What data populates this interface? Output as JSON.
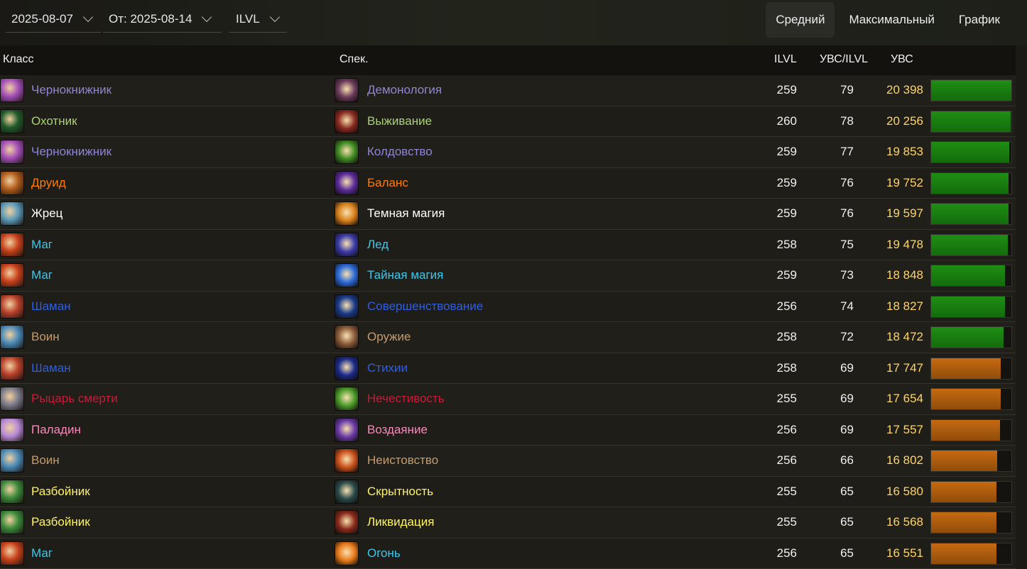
{
  "filters": {
    "date_from": "2025-08-07",
    "date_to": "От: 2025-08-14",
    "ilvl": "ILVL"
  },
  "tabs": [
    {
      "label": "Средний",
      "active": true
    },
    {
      "label": "Максимальный",
      "active": false
    },
    {
      "label": "График",
      "active": false
    }
  ],
  "table": {
    "headers": {
      "class": "Класс",
      "spec": "Спек.",
      "ilvl": "ILVL",
      "ratio": "УВС/ILVL",
      "dps": "УВС"
    },
    "max_dps": 20398,
    "rows": [
      {
        "class": "Чернокнижник",
        "spec": "Демонология",
        "ilvl": "259",
        "ratio": "79",
        "dps": "20 398",
        "dps_value": 20398,
        "color": "#8f86d6",
        "class_icon": "warlock-icon",
        "spec_icon": "demonology-icon",
        "class_icon_color": "#a44fb8",
        "spec_icon_color": "#6b3a5a",
        "bar": "green"
      },
      {
        "class": "Охотник",
        "spec": "Выживание",
        "ilvl": "260",
        "ratio": "78",
        "dps": "20 256",
        "dps_value": 20256,
        "color": "#aad372",
        "class_icon": "hunter-icon",
        "spec_icon": "survival-icon",
        "class_icon_color": "#1f5a2a",
        "spec_icon_color": "#8a2a20",
        "bar": "green"
      },
      {
        "class": "Чернокнижник",
        "spec": "Колдовство",
        "ilvl": "259",
        "ratio": "77",
        "dps": "19 853",
        "dps_value": 19853,
        "color": "#8f86d6",
        "class_icon": "warlock-icon",
        "spec_icon": "affliction-icon",
        "class_icon_color": "#a44fb8",
        "spec_icon_color": "#3e8a22",
        "bar": "green"
      },
      {
        "class": "Друид",
        "spec": "Баланс",
        "ilvl": "259",
        "ratio": "76",
        "dps": "19 752",
        "dps_value": 19752,
        "color": "#ff7c0a",
        "class_icon": "druid-icon",
        "spec_icon": "balance-icon",
        "class_icon_color": "#b05a1a",
        "spec_icon_color": "#5a2a9a",
        "bar": "green"
      },
      {
        "class": "Жрец",
        "spec": "Темная магия",
        "ilvl": "259",
        "ratio": "76",
        "dps": "19 597",
        "dps_value": 19597,
        "color": "#ffffff",
        "class_icon": "priest-icon",
        "spec_icon": "shadow-icon",
        "class_icon_color": "#5a9ab8",
        "spec_icon_color": "#d8801a",
        "bar": "green"
      },
      {
        "class": "Маг",
        "spec": "Лед",
        "ilvl": "258",
        "ratio": "75",
        "dps": "19 478",
        "dps_value": 19478,
        "color": "#3fc7eb",
        "class_icon": "mage-icon",
        "spec_icon": "frost-icon",
        "class_icon_color": "#c8401a",
        "spec_icon_color": "#3a3aa8",
        "bar": "green"
      },
      {
        "class": "Маг",
        "spec": "Тайная магия",
        "ilvl": "259",
        "ratio": "73",
        "dps": "18 848",
        "dps_value": 18848,
        "color": "#3fc7eb",
        "class_icon": "mage-icon",
        "spec_icon": "arcane-icon",
        "class_icon_color": "#c8401a",
        "spec_icon_color": "#2a6ad8",
        "bar": "green"
      },
      {
        "class": "Шаман",
        "spec": "Совершенствование",
        "ilvl": "256",
        "ratio": "74",
        "dps": "18 827",
        "dps_value": 18827,
        "color": "#2f5fe0",
        "class_icon": "shaman-icon",
        "spec_icon": "enhancement-icon",
        "class_icon_color": "#b8402a",
        "spec_icon_color": "#1a3a8a",
        "bar": "green"
      },
      {
        "class": "Воин",
        "spec": "Оружие",
        "ilvl": "258",
        "ratio": "72",
        "dps": "18 472",
        "dps_value": 18472,
        "color": "#c69b6d",
        "class_icon": "warrior-icon",
        "spec_icon": "arms-icon",
        "class_icon_color": "#4a8ab8",
        "spec_icon_color": "#8a5a3a",
        "bar": "green"
      },
      {
        "class": "Шаман",
        "spec": "Стихии",
        "ilvl": "258",
        "ratio": "69",
        "dps": "17 747",
        "dps_value": 17747,
        "color": "#2f5fe0",
        "class_icon": "shaman-icon",
        "spec_icon": "elemental-icon",
        "class_icon_color": "#b8402a",
        "spec_icon_color": "#1a2a8a",
        "bar": "orange"
      },
      {
        "class": "Рыцарь смерти",
        "spec": "Нечестивость",
        "ilvl": "255",
        "ratio": "69",
        "dps": "17 654",
        "dps_value": 17654,
        "color": "#c41e3a",
        "class_icon": "death-knight-icon",
        "spec_icon": "unholy-icon",
        "class_icon_color": "#7a7a8a",
        "spec_icon_color": "#4a9a2a",
        "bar": "orange"
      },
      {
        "class": "Паладин",
        "spec": "Воздаяние",
        "ilvl": "256",
        "ratio": "69",
        "dps": "17 557",
        "dps_value": 17557,
        "color": "#f48cba",
        "class_icon": "paladin-icon",
        "spec_icon": "retribution-icon",
        "class_icon_color": "#b88ad8",
        "spec_icon_color": "#6a3aa8",
        "bar": "orange"
      },
      {
        "class": "Воин",
        "spec": "Неистовство",
        "ilvl": "256",
        "ratio": "66",
        "dps": "16 802",
        "dps_value": 16802,
        "color": "#c69b6d",
        "class_icon": "warrior-icon",
        "spec_icon": "fury-icon",
        "class_icon_color": "#4a8ab8",
        "spec_icon_color": "#c8501a",
        "bar": "orange"
      },
      {
        "class": "Разбойник",
        "spec": "Скрытность",
        "ilvl": "255",
        "ratio": "65",
        "dps": "16 580",
        "dps_value": 16580,
        "color": "#fff468",
        "class_icon": "rogue-icon",
        "spec_icon": "subtlety-icon",
        "class_icon_color": "#3a8a3a",
        "spec_icon_color": "#2a4a4a",
        "bar": "orange"
      },
      {
        "class": "Разбойник",
        "spec": "Ликвидация",
        "ilvl": "255",
        "ratio": "65",
        "dps": "16 568",
        "dps_value": 16568,
        "color": "#fff468",
        "class_icon": "rogue-icon",
        "spec_icon": "assassination-icon",
        "class_icon_color": "#3a8a3a",
        "spec_icon_color": "#8a2a1a",
        "bar": "orange"
      },
      {
        "class": "Маг",
        "spec": "Огонь",
        "ilvl": "256",
        "ratio": "65",
        "dps": "16 551",
        "dps_value": 16551,
        "color": "#3fc7eb",
        "class_icon": "mage-icon",
        "spec_icon": "fire-icon",
        "class_icon_color": "#c8401a",
        "spec_icon_color": "#e87a1a",
        "bar": "orange"
      }
    ]
  }
}
